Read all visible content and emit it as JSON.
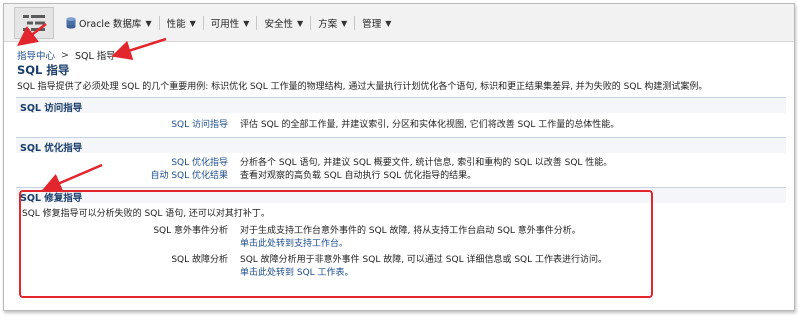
{
  "menubar": {
    "items": [
      {
        "label": "Oracle 数据库",
        "icon": "database-icon"
      },
      {
        "label": "性能"
      },
      {
        "label": "可用性"
      },
      {
        "label": "安全性"
      },
      {
        "label": "方案"
      },
      {
        "label": "管理"
      }
    ]
  },
  "breadcrumb": {
    "parent": "指导中心",
    "separator": ">",
    "current": "SQL 指导"
  },
  "page": {
    "title": "SQL 指导",
    "description": "SQL 指导提供了必须处理 SQL 的几个重要用例: 标识优化 SQL 工作量的物理结构, 通过大量执行计划优化各个语句, 标识和更正结果集差异, 并为失败的 SQL 构建测试案例。"
  },
  "sections": {
    "access": {
      "title": "SQL 访问指导",
      "rows": [
        {
          "link": "SQL 访问指导",
          "desc": "评估 SQL 的全部工作量, 并建议索引, 分区和实体化视图, 它们将改善 SQL 工作量的总体性能。"
        }
      ]
    },
    "tuning": {
      "title": "SQL 优化指导",
      "rows": [
        {
          "link": "SQL 优化指导",
          "desc": "分析各个 SQL 语句, 并建议 SQL 概要文件, 统计信息, 索引和重构的 SQL 以改善 SQL 性能。"
        },
        {
          "link": "自动 SQL 优化结果",
          "desc": "查看对观察的高负载 SQL 自动执行 SQL 优化指导的结果。"
        }
      ]
    },
    "repair": {
      "title": "SQL 修复指导",
      "intro": "SQL 修复指导可以分析失败的 SQL 语句, 还可以对其打补丁。",
      "rows": [
        {
          "label": "SQL 意外事件分析",
          "desc": "对于生成支持工作台意外事件的 SQL 故障, 将从支持工作台启动 SQL 意外事件分析。",
          "action": "单击此处转到支持工作台。"
        },
        {
          "label": "SQL 故障分析",
          "desc": "SQL 故障分析用于非意外事件 SQL 故障, 可以通过 SQL 详细信息或 SQL 工作表进行访问。",
          "action": "单击此处转到 SQL 工作表。"
        }
      ]
    }
  },
  "colors": {
    "link": "#1f4f8f",
    "title": "#1a3d6b",
    "annotation": "#e3262d"
  }
}
